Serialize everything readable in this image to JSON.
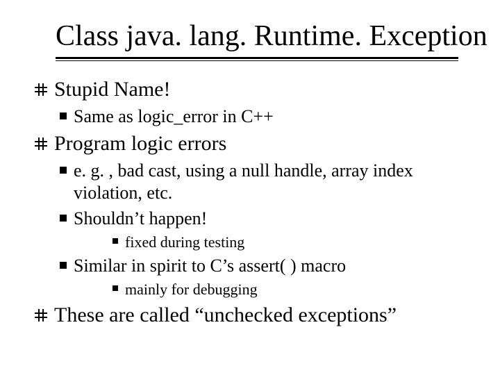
{
  "title": "Class java. lang. Runtime. Exception",
  "items": [
    {
      "text": "Stupid Name!",
      "sub": [
        {
          "text": "Same as logic_error in C++"
        }
      ]
    },
    {
      "text": "Program logic errors",
      "sub": [
        {
          "text": "e. g. , bad cast, using a null handle, array index violation, etc."
        },
        {
          "text": "Shouldn’t happen!",
          "sub": [
            {
              "text": "fixed during testing"
            }
          ]
        },
        {
          "text": "Similar in spirit to C’s assert( ) macro",
          "sub": [
            {
              "text": "mainly for debugging"
            }
          ]
        }
      ]
    },
    {
      "text": "These are called “unchecked exceptions”"
    }
  ]
}
